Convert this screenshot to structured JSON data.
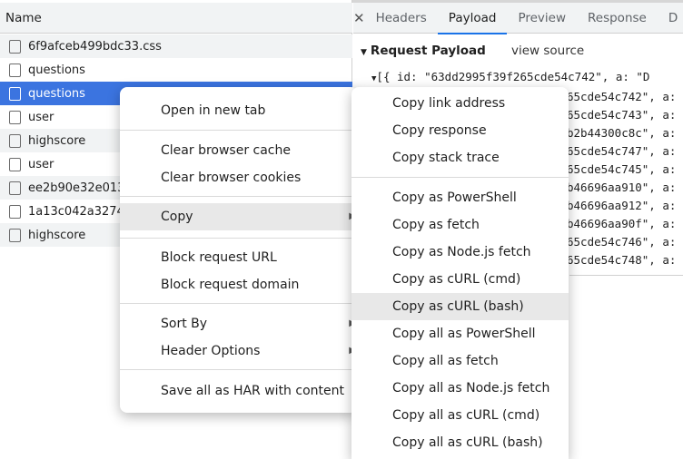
{
  "network_list": {
    "header": "Name",
    "rows": [
      {
        "name": "6f9afceb499bdc33.css"
      },
      {
        "name": "questions"
      },
      {
        "name": "questions",
        "selected": true
      },
      {
        "name": "user"
      },
      {
        "name": "highscore"
      },
      {
        "name": "user"
      },
      {
        "name": "ee2b90e32e013"
      },
      {
        "name": "1a13c042a3274"
      },
      {
        "name": "highscore"
      }
    ]
  },
  "details": {
    "close_icon": "close-icon",
    "tabs": [
      "Headers",
      "Payload",
      "Preview",
      "Response",
      "D"
    ],
    "active_tab": "Payload",
    "payload_title": "Request Payload",
    "view_source": "view source",
    "first_line": "[{ id: \"63dd2995f39f265cde54c742\", a: \"D",
    "lines": [
      "65cde54c742\", a:",
      "65cde54c743\", a:",
      "b2b44300c8c\", a:",
      "65cde54c747\", a:",
      "65cde54c745\", a:",
      "b46696aa910\", a:",
      "b46696aa912\", a:",
      "b46696aa90f\", a:",
      "65cde54c746\", a:",
      "65cde54c748\", a:"
    ]
  },
  "context_menu": {
    "items": [
      "Open in new tab",
      "Clear browser cache",
      "Clear browser cookies",
      "Copy",
      "Block request URL",
      "Block request domain",
      "Sort By",
      "Header Options",
      "Save all as HAR with content"
    ],
    "highlighted": "Copy"
  },
  "copy_submenu": {
    "items": [
      "Copy link address",
      "Copy response",
      "Copy stack trace",
      "Copy as PowerShell",
      "Copy as fetch",
      "Copy as Node.js fetch",
      "Copy as cURL (cmd)",
      "Copy as cURL (bash)",
      "Copy all as PowerShell",
      "Copy all as fetch",
      "Copy all as Node.js fetch",
      "Copy all as cURL (cmd)",
      "Copy all as cURL (bash)"
    ],
    "highlighted": "Copy as cURL (bash)"
  },
  "colors": {
    "selection": "#3b74e0",
    "accent": "#1a73e8"
  }
}
